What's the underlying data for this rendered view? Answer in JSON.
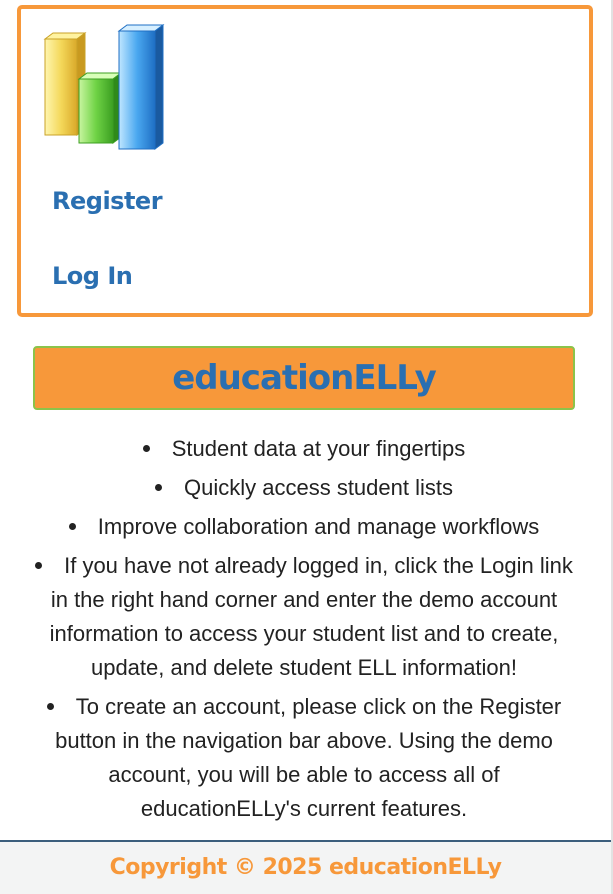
{
  "nav": {
    "logo_icon": "bar-chart-logo-icon",
    "register_label": "Register",
    "login_label": "Log In"
  },
  "banner": {
    "title": "educationELLy"
  },
  "features": [
    "Student data at your fingertips",
    "Quickly access student lists",
    "Improve collaboration and manage workflows",
    "If you have not already logged in, click the Login link in the right hand corner and enter the demo account information to access your student list and to create, update, and delete student ELL information!",
    "To create an account, please click on the Register button in the navigation bar above. Using the demo account, you will be able to access all of educationELLy's current features."
  ],
  "footer": {
    "copyright": "Copyright © 2025 educationELLy"
  },
  "colors": {
    "accent_orange": "#f7983a",
    "link_blue": "#2a6fb1",
    "banner_border_green": "#8bc34a",
    "footer_border": "#3b5e7c"
  }
}
